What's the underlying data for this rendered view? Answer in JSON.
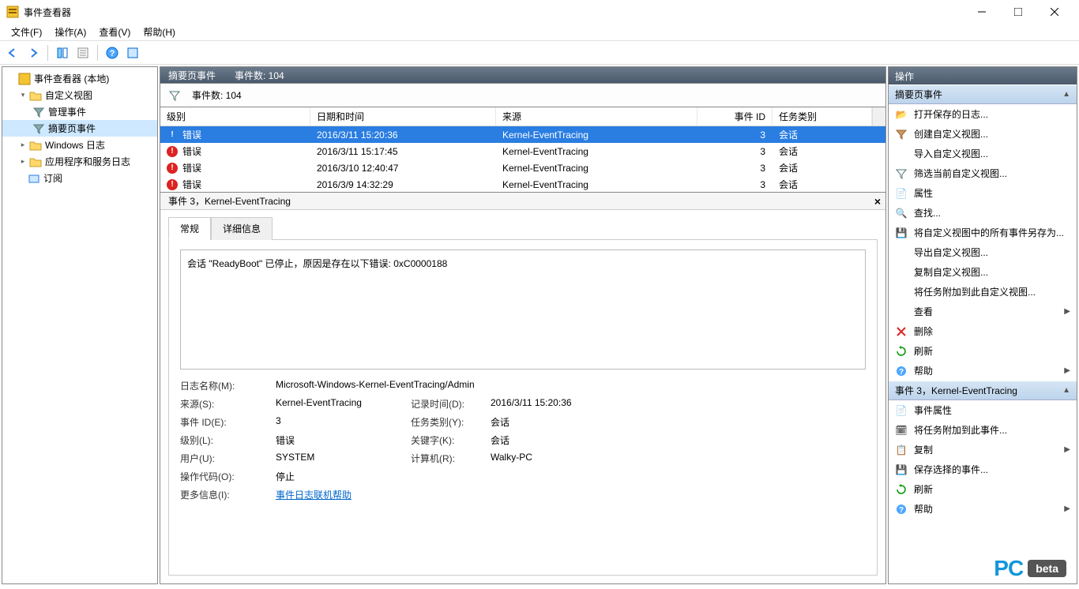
{
  "window": {
    "title": "事件查看器"
  },
  "menu": {
    "file": "文件(F)",
    "action": "操作(A)",
    "view": "查看(V)",
    "help": "帮助(H)"
  },
  "tree": {
    "root": "事件查看器 (本地)",
    "custom": "自定义视图",
    "admin": "管理事件",
    "summary": "摘要页事件",
    "windows": "Windows 日志",
    "apps": "应用程序和服务日志",
    "subs": "订阅"
  },
  "header": {
    "title": "摘要页事件",
    "count_label": "事件数: 104"
  },
  "filter": {
    "count": "事件数: 104"
  },
  "columns": {
    "level": "级别",
    "date": "日期和时间",
    "source": "来源",
    "id": "事件 ID",
    "cat": "任务类别"
  },
  "rows": [
    {
      "level": "错误",
      "date": "2016/3/11 15:20:36",
      "source": "Kernel-EventTracing",
      "id": "3",
      "cat": "会话",
      "sel": true,
      "info": true
    },
    {
      "level": "错误",
      "date": "2016/3/11 15:17:45",
      "source": "Kernel-EventTracing",
      "id": "3",
      "cat": "会话"
    },
    {
      "level": "错误",
      "date": "2016/3/10 12:40:47",
      "source": "Kernel-EventTracing",
      "id": "3",
      "cat": "会话"
    },
    {
      "level": "错误",
      "date": "2016/3/9 14:32:29",
      "source": "Kernel-EventTracing",
      "id": "3",
      "cat": "会话"
    }
  ],
  "detail": {
    "title": "事件 3，Kernel-EventTracing",
    "tab_general": "常规",
    "tab_details": "详细信息",
    "message": "会话 \"ReadyBoot\" 已停止，原因是存在以下错误: 0xC0000188",
    "log_name_lbl": "日志名称(M):",
    "log_name": "Microsoft-Windows-Kernel-EventTracing/Admin",
    "source_lbl": "来源(S):",
    "source": "Kernel-EventTracing",
    "logged_lbl": "记录时间(D):",
    "logged": "2016/3/11 15:20:36",
    "id_lbl": "事件 ID(E):",
    "id": "3",
    "cat_lbl": "任务类别(Y):",
    "cat": "会话",
    "level_lbl": "级别(L):",
    "level": "错误",
    "kw_lbl": "关键字(K):",
    "kw": "会话",
    "user_lbl": "用户(U):",
    "user": "SYSTEM",
    "comp_lbl": "计算机(R):",
    "comp": "Walky-PC",
    "op_lbl": "操作代码(O):",
    "op": "停止",
    "more_lbl": "更多信息(I):",
    "more": "事件日志联机帮助"
  },
  "actions": {
    "title": "操作",
    "group1": "摘要页事件",
    "open_saved": "打开保存的日志...",
    "create_view": "创建自定义视图...",
    "import_view": "导入自定义视图...",
    "filter_view": "筛选当前自定义视图...",
    "properties": "属性",
    "find": "查找...",
    "save_all": "将自定义视图中的所有事件另存为...",
    "export_view": "导出自定义视图...",
    "copy_view": "复制自定义视图...",
    "attach_task": "将任务附加到此自定义视图...",
    "view": "查看",
    "delete": "删除",
    "refresh": "刷新",
    "help": "帮助",
    "group2": "事件 3，Kernel-EventTracing",
    "event_props": "事件属性",
    "attach_event": "将任务附加到此事件...",
    "copy": "复制",
    "save_sel": "保存选择的事件...",
    "refresh2": "刷新",
    "help2": "帮助"
  },
  "watermark": {
    "text": "PC",
    "beta": "beta"
  }
}
